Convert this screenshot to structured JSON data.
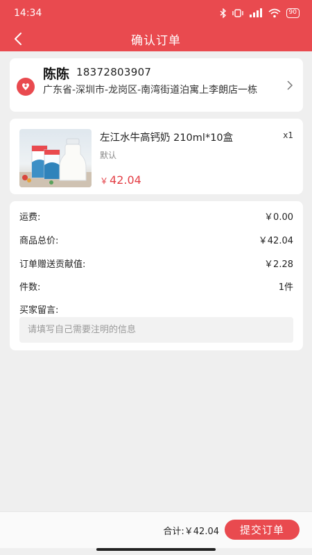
{
  "status_bar": {
    "time": "14:34",
    "battery": "90",
    "icons": [
      "bluetooth-icon",
      "vibrate-icon",
      "signal-icon",
      "wifi-icon",
      "battery-icon"
    ]
  },
  "header": {
    "title": "确认订单",
    "back_icon": "back-arrow-icon"
  },
  "address": {
    "name": "陈陈",
    "phone": "18372803907",
    "detail": "广东省-深圳市-龙岗区-南湾街道泊寓上李朗店一栋",
    "icon": "location-pin-icon"
  },
  "goods": {
    "name": "左江水牛高钙奶 210ml*10盒",
    "quantity": "x1",
    "spec": "默认",
    "currency": "￥",
    "price": "42.04"
  },
  "summary": {
    "shipping_label": "运费:",
    "shipping_value": "￥0.00",
    "goods_total_label": "商品总价:",
    "goods_total_value": "￥42.04",
    "contribution_label": "订单赠送贡献值:",
    "contribution_value": "￥2.28",
    "count_label": "件数:",
    "count_value": "1件",
    "note_label": "买家留言:",
    "note_placeholder": "请填写自己需要注明的信息"
  },
  "footer": {
    "total_text": "合计:￥42.04",
    "submit_label": "提交订单"
  },
  "colors": {
    "accent": "#e94a4f",
    "price": "#e33d44",
    "background": "#efefef"
  }
}
